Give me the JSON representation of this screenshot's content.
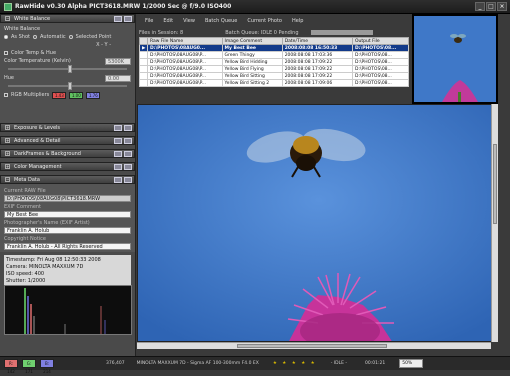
{
  "window": {
    "title": "RawHide v0.30 Alpha   PICT3618.MRW   1/2000 Sec @ f/9.0  ISO400"
  },
  "left_panel": {
    "white_balance": {
      "header": "White Balance",
      "group_label": "White Balance",
      "as_shot": "As Shot",
      "automatic": "Automatic",
      "selected_point": "Selected Point",
      "xy": "X -  Y -",
      "color_temp_hue": "Color Temp & Hue",
      "color_temp_label": "Color Temperature (Kelvin)",
      "color_temp_value": "5300K",
      "hue_label": "Hue",
      "hue_value": "0.00",
      "rgb_label": "RGB Multipliers",
      "rgb_r": "1.43",
      "rgb_g": "1.00",
      "rgb_b": "1.76"
    },
    "sections": [
      "Exposure & Levels",
      "Advanced & Detail",
      "DarkFrames & Background",
      "Color Management",
      "Meta Data"
    ],
    "meta": {
      "current_raw_label": "Current RAW File",
      "current_raw_value": "D:\\PHOTOS\\08AUG08\\PICT3618.MRW",
      "exif_comment_label": "EXIF Comment",
      "exif_comment_value": "My Best Bee",
      "photographer_label": "Photographer's Name (EXIF Artist)",
      "photographer_value": "Franklin A. Holub",
      "copyright_label": "Copyright Notice",
      "copyright_value": "Franklin A. Holub - All Rights Reserved",
      "exif_lines": [
        "Timestamp: Fri Aug 08 12:50:33 2008",
        "Camera: MINOLTA MAXXUM 7D",
        "ISO speed: 400",
        "Shutter: 1/2000"
      ]
    }
  },
  "menu": [
    "File",
    "Edit",
    "View",
    "Batch Queue",
    "Current Photo",
    "Help"
  ],
  "info": {
    "files_in_session": "Files in Session: 8",
    "batch_queue": "Batch Queue: IDLE  0 Pending"
  },
  "table": {
    "headers": [
      "Raw File Name",
      "Image Comment",
      "Date/Time",
      "Output File"
    ],
    "rows": [
      [
        "D:\\PHOTOS\\08AUG0...",
        "My Best Bee",
        "2008:08:08 16:50:33",
        "D:\\PHOTOS\\08..."
      ],
      [
        "D:\\PHOTOS\\08AUG08\\P...",
        "Green Thingy",
        "2008:08:08 17:03:36",
        "D:\\PHOTOS\\08..."
      ],
      [
        "D:\\PHOTOS\\08AUG08\\P...",
        "Yellow Bird Hidding",
        "2008:08:08 17:09:22",
        "D:\\PHOTOS\\08..."
      ],
      [
        "D:\\PHOTOS\\08AUG08\\P...",
        "Yellow Bird Flying",
        "2008:08:08 17:09:22",
        "D:\\PHOTOS\\08..."
      ],
      [
        "D:\\PHOTOS\\08AUG08\\P...",
        "Yellow Bird Sitting",
        "2008:08:08 17:09:22",
        "D:\\PHOTOS\\08..."
      ],
      [
        "D:\\PHOTOS\\08AUG08\\P...",
        "Yellow Bird Sitting 2",
        "2008:08:08 17:09:06",
        "D:\\PHOTOS\\08..."
      ]
    ]
  },
  "status": {
    "r": "R: 142",
    "g": "G: 171",
    "b": "B: 214",
    "xy": "376,407",
    "lens": "MINOLTA MAXXUM 7D - Sigma AF 100-300mm F4.0 EX",
    "stars": "★ ★ ★ ★ ★",
    "state": "- IDLE -",
    "time": "00:01:21",
    "zoom": "50%"
  },
  "colors": {
    "accent": "#123a8a",
    "sky": "#3f78c8"
  }
}
